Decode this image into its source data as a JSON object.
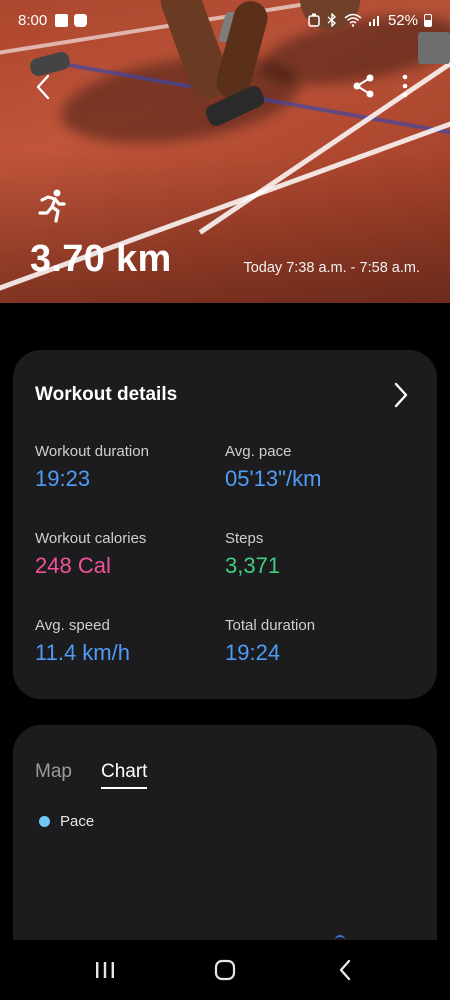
{
  "status_bar": {
    "time": "8:00",
    "battery": "52%"
  },
  "hero": {
    "distance": "3.70 km",
    "date_range": "Today 7:38 a.m. - 7:58 a.m.",
    "activity_icon": "running-icon"
  },
  "workout_details": {
    "title": "Workout details",
    "metrics": [
      {
        "label": "Workout duration",
        "value": "19:23",
        "color": "#4e9cf5"
      },
      {
        "label": "Avg. pace",
        "value": "05'13\"/km",
        "color": "#4e9cf5"
      },
      {
        "label": "Workout calories",
        "value": "248 Cal",
        "color": "#f0529c"
      },
      {
        "label": "Steps",
        "value": "3,371",
        "color": "#3fcf7e"
      },
      {
        "label": "Avg. speed",
        "value": "11.4 km/h",
        "color": "#4e9cf5"
      },
      {
        "label": "Total duration",
        "value": "19:24",
        "color": "#4e9cf5"
      }
    ]
  },
  "chart_card": {
    "tabs": [
      {
        "label": "Map",
        "selected": false
      },
      {
        "label": "Chart",
        "selected": true
      }
    ],
    "legend": "Pace",
    "legend_color": "#6fc6f7"
  },
  "icons": {
    "back": "back-arrow-icon",
    "share": "share-icon",
    "more": "more-options-icon",
    "chevron": "chevron-right-icon"
  },
  "navbar": {
    "buttons": [
      "recent-apps-icon",
      "home-icon",
      "back-icon"
    ]
  }
}
